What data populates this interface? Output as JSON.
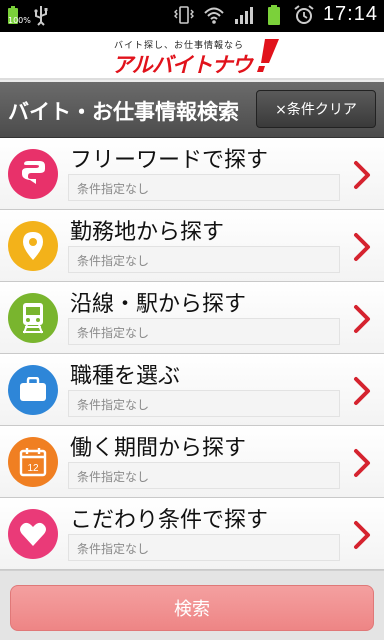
{
  "status_bar": {
    "battery_percent": "100%",
    "time": "17:14"
  },
  "header": {
    "logo_tagline": "バイト探し、お仕事情報なら",
    "logo_name": "アルバイトナウ"
  },
  "titlebar": {
    "title": "バイト・お仕事情報検索",
    "clear_label": "×条件クリア"
  },
  "items": [
    {
      "label": "フリーワードで探す",
      "condition": "条件指定なし",
      "icon": "speech-bubble-icon",
      "color": "#e8316a"
    },
    {
      "label": "勤務地から探す",
      "condition": "条件指定なし",
      "icon": "location-pin-icon",
      "color": "#f3b21a"
    },
    {
      "label": "沿線・駅から探す",
      "condition": "条件指定なし",
      "icon": "train-icon",
      "color": "#79b52e"
    },
    {
      "label": "職種を選ぶ",
      "condition": "条件指定なし",
      "icon": "briefcase-icon",
      "color": "#2e86d8"
    },
    {
      "label": "働く期間から探す",
      "condition": "条件指定なし",
      "icon": "calendar-icon",
      "color": "#f07f22"
    },
    {
      "label": "こだわり条件で探す",
      "condition": "条件指定なし",
      "icon": "heart-icon",
      "color": "#ea3a78"
    }
  ],
  "calendar_day": "12",
  "footer": {
    "search_label": "検索"
  },
  "colors": {
    "accent_red": "#e1121b",
    "chevron_red": "#d5232f",
    "search_button": "#ee8585"
  }
}
